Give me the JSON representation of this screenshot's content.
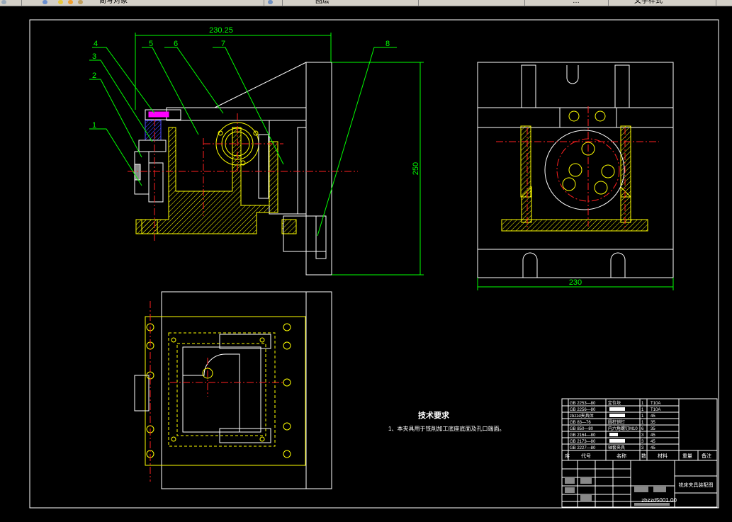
{
  "toolbar": {
    "item_a": "…",
    "item_b": "简写对象",
    "item_c": "…",
    "item_d": "图层",
    "item_e": "文字样式"
  },
  "drawing": {
    "dims": {
      "top_width": "230.25",
      "height": "250",
      "right_width": "230"
    },
    "part_labels": [
      "1",
      "2",
      "3",
      "4",
      "5",
      "6",
      "7",
      "8"
    ],
    "tech": {
      "title": "技术要求",
      "line1": "1、本夹具用于铣削加工底座底面及孔口端面。"
    },
    "bom_rows": [
      {
        "code": "GB 2253—80",
        "name": "定位块",
        "qty": "1",
        "mat": "T10A"
      },
      {
        "code": "GB 2256—80",
        "name": "",
        "qty": "1",
        "mat": "T10A"
      },
      {
        "code": "zbzzd夹具体",
        "name": "",
        "qty": "1",
        "mat": "45"
      },
      {
        "code": "GB 83—76",
        "name": "圆柱销钉",
        "qty": "1",
        "mat": "35"
      },
      {
        "code": "GB 850—80",
        "name": "内六角螺钉M10",
        "qty": "6",
        "mat": "35"
      },
      {
        "code": "GB 2164—80",
        "name": "",
        "qty": "3",
        "mat": "45"
      },
      {
        "code": "GB 2173—80",
        "name": "",
        "qty": "3",
        "mat": "45"
      },
      {
        "code": "GB 2227—80",
        "name": "轴套夹具",
        "qty": "3",
        "mat": "45"
      }
    ],
    "bom_header": {
      "seq": "序",
      "code": "代号",
      "name": "名称",
      "qty": "数",
      "mat": "材料",
      "weight": "重量",
      "note": "备注"
    },
    "title_block": {
      "drawing_title": "铣床夹具装配图",
      "drawing_no": "zbzzd5001.00"
    }
  }
}
